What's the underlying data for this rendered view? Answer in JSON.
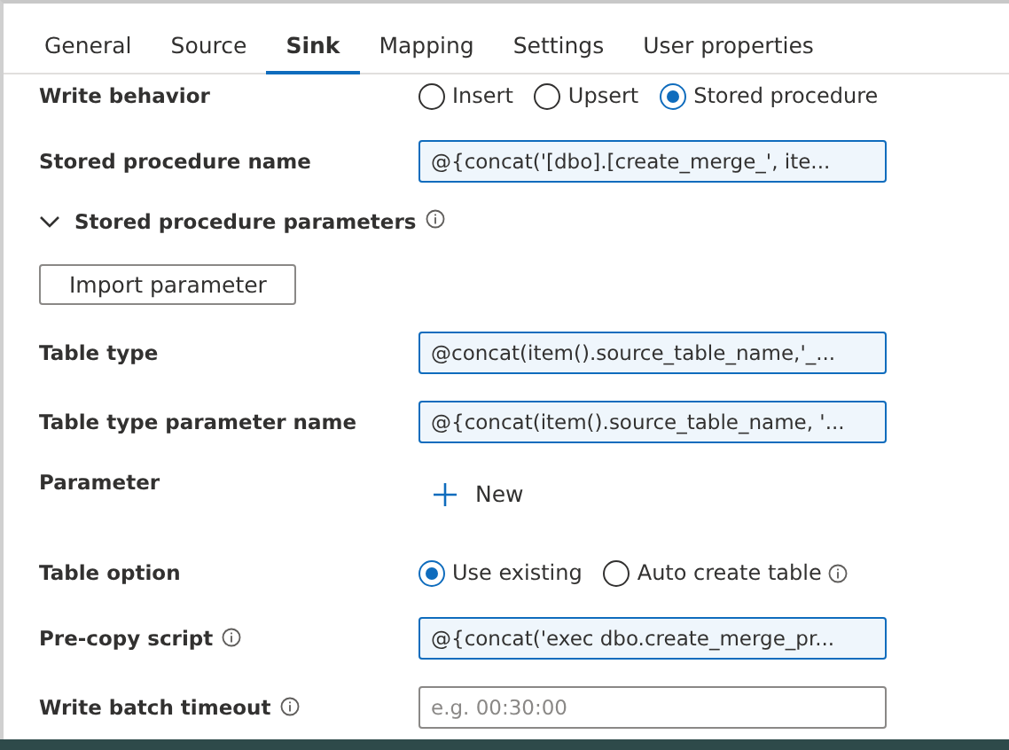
{
  "tabs": [
    {
      "label": "General",
      "selected": false
    },
    {
      "label": "Source",
      "selected": false
    },
    {
      "label": "Sink",
      "selected": true
    },
    {
      "label": "Mapping",
      "selected": false
    },
    {
      "label": "Settings",
      "selected": false
    },
    {
      "label": "User properties",
      "selected": false
    }
  ],
  "rows": [
    {
      "kind": "radio",
      "label": "Write behavior",
      "options": [
        {
          "label": "Insert",
          "selected": false
        },
        {
          "label": "Upsert",
          "selected": false
        },
        {
          "label": "Stored procedure",
          "selected": true
        }
      ]
    },
    {
      "kind": "field",
      "label": "Stored procedure name",
      "value": "@{concat('[dbo].[create_merge_', ite...",
      "filled": true
    },
    {
      "kind": "section",
      "label": "Stored procedure parameters",
      "expanded": true,
      "info": true
    },
    {
      "kind": "button",
      "label": "Import parameter"
    },
    {
      "kind": "field",
      "label": "Table type",
      "value": "@concat(item().source_table_name,'_...",
      "filled": true
    },
    {
      "kind": "field",
      "label": "Table type parameter name",
      "value": "@{concat(item().source_table_name, '...",
      "filled": true
    },
    {
      "kind": "new",
      "label": "Parameter",
      "action": "New"
    },
    {
      "kind": "radio",
      "label": "Table option",
      "options": [
        {
          "label": "Use existing",
          "selected": true
        },
        {
          "label": "Auto create table",
          "selected": false,
          "info": true
        }
      ]
    },
    {
      "kind": "field",
      "label": "Pre-copy script",
      "info": true,
      "value": "@{concat('exec dbo.create_merge_pr...",
      "filled": true
    },
    {
      "kind": "field",
      "label": "Write batch timeout",
      "info": true,
      "placeholder": "e.g. 00:30:00",
      "filled": false
    }
  ]
}
